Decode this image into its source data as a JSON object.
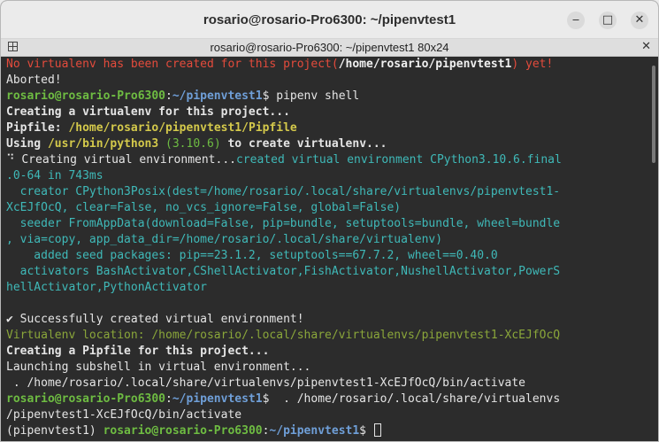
{
  "window": {
    "title": "rosario@rosario-Pro6300: ~/pipenvtest1",
    "minimize_label": "‒",
    "maximize_label": "□",
    "close_label": "✕"
  },
  "tab": {
    "title": "rosario@rosario-Pro6300: ~/pipenvtest1 80x24",
    "close_label": "✕"
  },
  "terminal": {
    "l1a": "No virtualenv has been created for this project(",
    "l1b": "/home/rosario/pipenvtest1",
    "l1c": ") yet!",
    "l2": "Aborted!",
    "prompt_user": "rosario@rosario-Pro6300",
    "prompt_sep": ":",
    "prompt_dir": "~/pipenvtest1",
    "prompt_dollar": "$ ",
    "cmd1": "pipenv shell",
    "l4": "Creating a virtualenv for this project...",
    "l5a": "Pipfile: ",
    "l5b": "/home/rosario/pipenvtest1/Pipfile",
    "l6a": "Using ",
    "l6b": "/usr/bin/python3",
    "l6c": " (3.10.6) ",
    "l6d": "to create virtualenv...",
    "l7a": "⠙ Creating virtual environment...",
    "l7b": "created virtual environment CPython3.10.6.final",
    "l8": ".0-64 in 743ms",
    "l9": "  creator CPython3Posix(dest=/home/rosario/.local/share/virtualenvs/pipenvtest1-",
    "l10": "XcEJfOcQ, clear=False, no_vcs_ignore=False, global=False)",
    "l11": "  seeder FromAppData(download=False, pip=bundle, setuptools=bundle, wheel=bundle",
    "l12": ", via=copy, app_data_dir=/home/rosario/.local/share/virtualenv)",
    "l13": "    added seed packages: pip==23.1.2, setuptools==67.7.2, wheel==0.40.0",
    "l14": "  activators BashActivator,CShellActivator,FishActivator,NushellActivator,PowerS",
    "l15": "hellActivator,PythonActivator",
    "l17": "✔ Successfully created virtual environment!",
    "l18": "Virtualenv location: /home/rosario/.local/share/virtualenvs/pipenvtest1-XcEJfOcQ",
    "l19": "Creating a Pipfile for this project...",
    "l20": "Launching subshell in virtual environment...",
    "l21": " . /home/rosario/.local/share/virtualenvs/pipenvtest1-XcEJfOcQ/bin/activate",
    "cmd2": " . /home/rosario/.local/share/virtualenvs",
    "l23": "/pipenvtest1-XcEJfOcQ/bin/activate",
    "venv_prefix": "(pipenvtest1) "
  },
  "colors": {
    "terminal_bg": "#2c2c2c",
    "error_red": "#e44b3c",
    "prompt_green": "#6ebc42",
    "prompt_blue": "#6f9fd8",
    "info_cyan": "#3fb9b8",
    "path_yellow": "#d4c94b"
  }
}
